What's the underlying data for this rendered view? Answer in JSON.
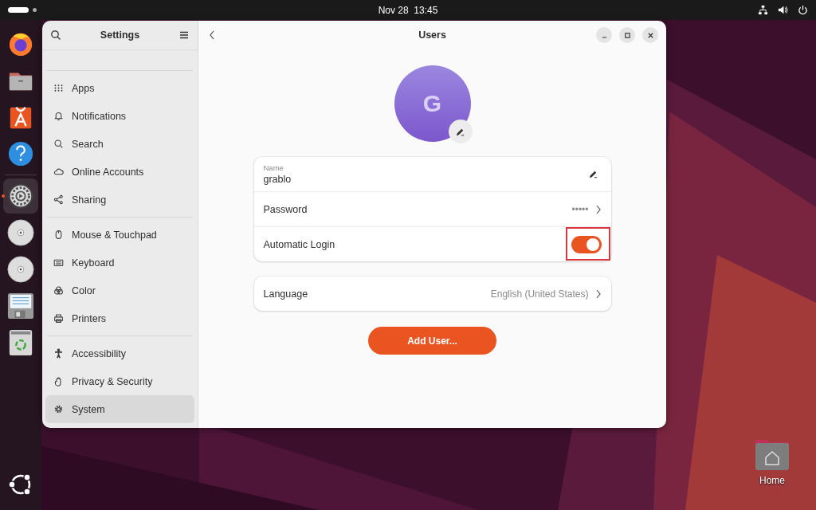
{
  "top_bar": {
    "clock": "Nov 28  13:45"
  },
  "dock": [
    {
      "kind": "firefox",
      "selected": false
    },
    {
      "kind": "files",
      "selected": false
    },
    {
      "kind": "store",
      "selected": false
    },
    {
      "kind": "help",
      "selected": false
    },
    {
      "kind": "settings",
      "selected": true
    },
    {
      "kind": "disc",
      "selected": false
    },
    {
      "kind": "disc",
      "selected": false
    },
    {
      "kind": "floppy",
      "selected": false
    },
    {
      "kind": "trash",
      "selected": false
    }
  ],
  "sidebar": {
    "title": "Settings",
    "groups": [
      [
        {
          "label": "Apps",
          "kind": "apps",
          "selected": false
        },
        {
          "label": "Notifications",
          "kind": "bell",
          "selected": false
        },
        {
          "label": "Search",
          "kind": "search",
          "selected": false
        },
        {
          "label": "Online Accounts",
          "kind": "cloud",
          "selected": false
        },
        {
          "label": "Sharing",
          "kind": "share",
          "selected": false
        }
      ],
      [
        {
          "label": "Mouse & Touchpad",
          "kind": "mouse",
          "selected": false
        },
        {
          "label": "Keyboard",
          "kind": "keyboard",
          "selected": false
        },
        {
          "label": "Color",
          "kind": "color",
          "selected": false
        },
        {
          "label": "Printers",
          "kind": "printer",
          "selected": false
        }
      ],
      [
        {
          "label": "Accessibility",
          "kind": "person",
          "selected": false
        },
        {
          "label": "Privacy & Security",
          "kind": "hand",
          "selected": false
        },
        {
          "label": "System",
          "kind": "gear",
          "selected": true
        }
      ]
    ]
  },
  "window": {
    "title": "Users"
  },
  "user": {
    "initial": "G",
    "name_label": "Name",
    "name": "grablo",
    "password_label": "Password",
    "password_value": "•••••",
    "autologin_label": "Automatic Login",
    "autologin_on": true,
    "autologin_highlighted": true,
    "language_label": "Language",
    "language_value": "English (United States)"
  },
  "add_button": "Add User...",
  "desktop_icons": [
    {
      "label": "Home"
    }
  ]
}
